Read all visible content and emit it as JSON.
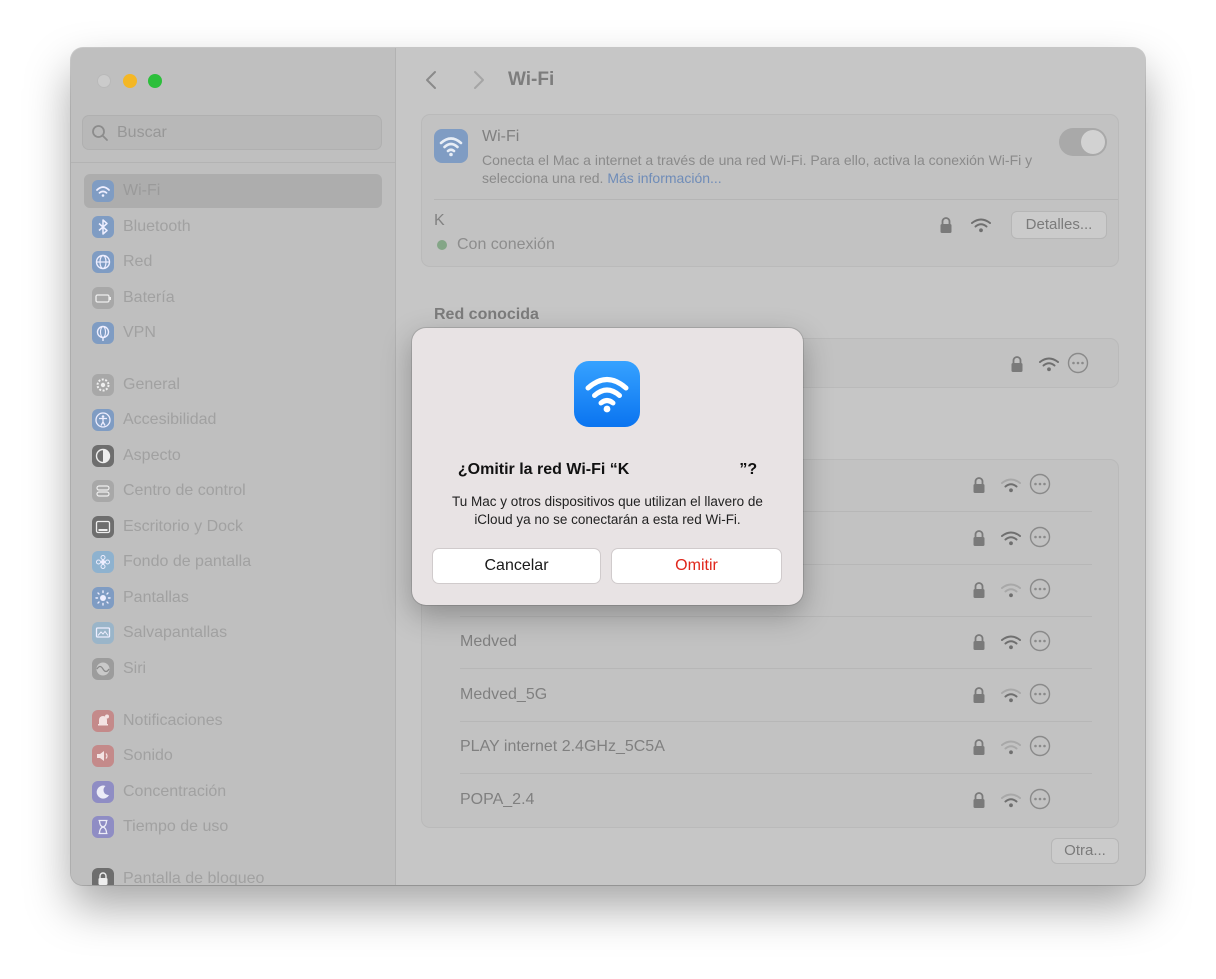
{
  "window": {
    "title": "Wi-Fi"
  },
  "sidebar": {
    "search_placeholder": "Buscar",
    "items": [
      {
        "label": "Wi-Fi",
        "icon": "wifi-icon",
        "color": "#7f9cc3",
        "active": true
      },
      {
        "label": "Bluetooth",
        "icon": "bluetooth-icon",
        "color": "#7f9cc3"
      },
      {
        "label": "Red",
        "icon": "globe-icon",
        "color": "#7f9cc3"
      },
      {
        "label": "Batería",
        "icon": "battery-icon",
        "color": "#a8a8a8"
      },
      {
        "label": "VPN",
        "icon": "vpn-globe-icon",
        "color": "#7f9cc3"
      },
      {
        "label": "General",
        "icon": "gear-icon",
        "color": "#a8a8a8"
      },
      {
        "label": "Accesibilidad",
        "icon": "accessibility-icon",
        "color": "#7f9cc3"
      },
      {
        "label": "Aspecto",
        "icon": "appearance-icon",
        "color": "#6e6e6e"
      },
      {
        "label": "Centro de control",
        "icon": "control-center-icon",
        "color": "#a8a8a8"
      },
      {
        "label": "Escritorio y Dock",
        "icon": "dock-icon",
        "color": "#6e6e6e"
      },
      {
        "label": "Fondo de pantalla",
        "icon": "wallpaper-icon",
        "color": "#8eb2cf"
      },
      {
        "label": "Pantallas",
        "icon": "display-icon",
        "color": "#7f9cc3"
      },
      {
        "label": "Salvapantallas",
        "icon": "screensaver-icon",
        "color": "#9ab5c9"
      },
      {
        "label": "Siri",
        "icon": "siri-icon",
        "color": "#9c9c9c"
      },
      {
        "label": "Notificaciones",
        "icon": "bell-icon",
        "color": "#c48a8a"
      },
      {
        "label": "Sonido",
        "icon": "speaker-icon",
        "color": "#c48a8a"
      },
      {
        "label": "Concentración",
        "icon": "moon-icon",
        "color": "#8f8dc4"
      },
      {
        "label": "Tiempo de uso",
        "icon": "hourglass-icon",
        "color": "#8f8dc4"
      },
      {
        "label": "Pantalla de bloqueo",
        "icon": "lock-icon",
        "color": "#6e6e6e"
      }
    ]
  },
  "main": {
    "wifi_card": {
      "title": "Wi-Fi",
      "description": "Conecta el Mac a internet a través de una red Wi-Fi. Para ello, activa la conexión Wi-Fi y selecciona una red.",
      "link": "Más información...",
      "toggle_on": true
    },
    "current_network": {
      "name": "K",
      "status": "Con conexión",
      "details_button": "Detalles..."
    },
    "known_section_title": "Red conocida",
    "other_networks": [
      {
        "name": "Medved"
      },
      {
        "name": "Medved_5G"
      },
      {
        "name": "PLAY internet 2.4GHz_5C5A"
      },
      {
        "name": "POPA_2.4"
      }
    ],
    "other_button": "Otra..."
  },
  "dialog": {
    "icon": "wifi-icon",
    "title_prefix": "¿Omitir la red Wi-Fi “K",
    "title_suffix": "”?",
    "body": "Tu Mac y otros dispositivos que utilizan el llavero de iCloud ya no se conectarán a esta red Wi-Fi.",
    "cancel_label": "Cancelar",
    "omit_label": "Omitir",
    "omit_color": "#e0261b"
  }
}
